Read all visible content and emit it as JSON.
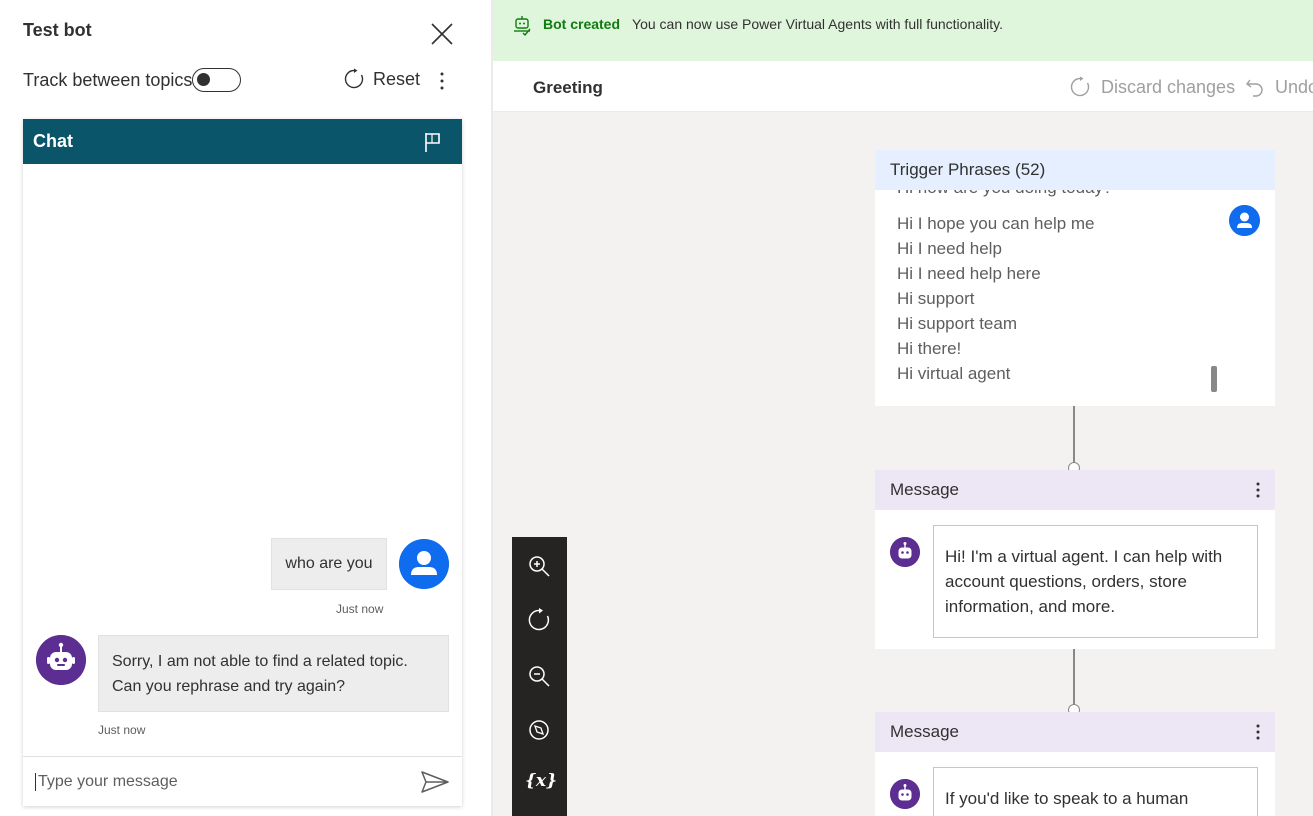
{
  "testbot": {
    "title": "Test bot",
    "track_label": "Track between topics",
    "track_enabled": false,
    "reset_label": "Reset"
  },
  "chat": {
    "header": "Chat",
    "messages": [
      {
        "from": "user",
        "text": "who are you",
        "time": "Just now"
      },
      {
        "from": "bot",
        "text": "Sorry, I am not able to find a related topic. Can you rephrase and try again?",
        "time": "Just now"
      }
    ],
    "input_placeholder": "Type your message"
  },
  "banner": {
    "title": "Bot created",
    "text": "You can now use Power Virtual Agents with full functionality."
  },
  "topic": {
    "name": "Greeting",
    "discard_label": "Discard changes",
    "undo_label": "Undo"
  },
  "trigger": {
    "title": "Trigger Phrases (52)",
    "phrases": [
      "Hi how are you doing today?",
      "Hi I hope you can help me",
      "Hi I need help",
      "Hi I need help here",
      "Hi support",
      "Hi support team",
      "Hi there!",
      "Hi virtual agent"
    ]
  },
  "messages": [
    {
      "title": "Message",
      "text": "Hi! I'm a virtual agent. I can help with account questions, orders, store information, and more."
    },
    {
      "title": "Message",
      "text": "If you'd like to speak to a human"
    }
  ],
  "zoombar": {
    "variables_label": "{x}"
  },
  "colors": {
    "chat_header": "#0b556a",
    "user_avatar": "#0f6cee",
    "bot_avatar": "#5c2e91",
    "banner_bg": "#dff6dd",
    "banner_title": "#107c10",
    "trigger_header": "#e5efff",
    "message_header": "#ede6f4"
  }
}
